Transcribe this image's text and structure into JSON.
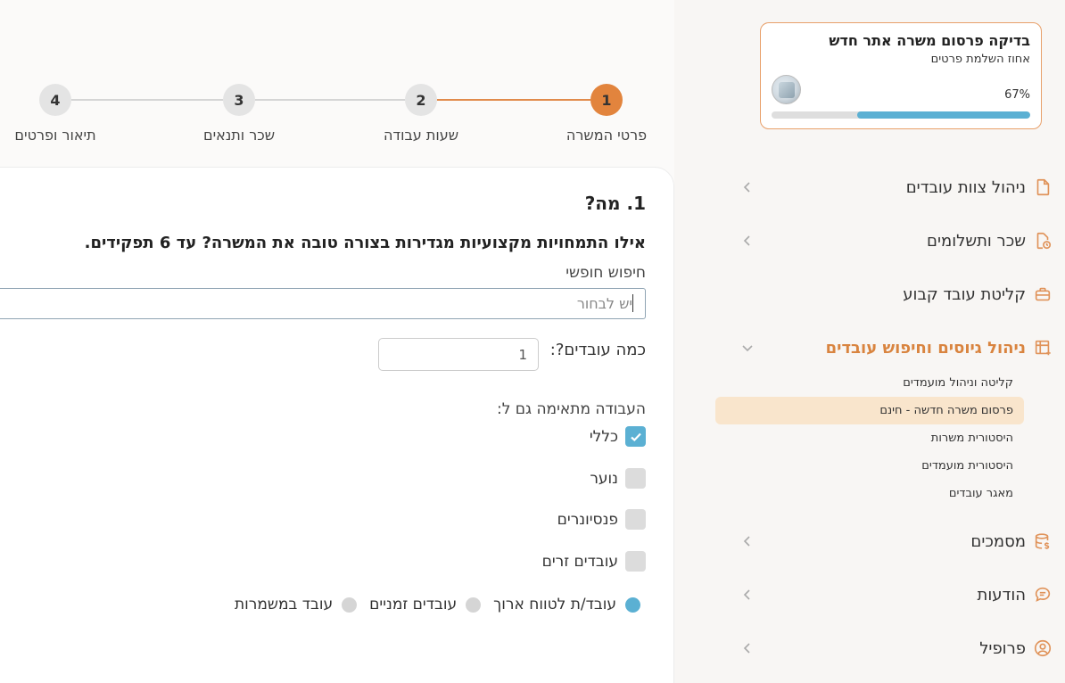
{
  "progress_card": {
    "title": "בדיקה פרסום משרה אתר חדש",
    "subtitle": "אחוז השלמת פרטים",
    "percent_text": "67%",
    "percent": 67
  },
  "nav": {
    "items": [
      {
        "label": "ניהול צוות עובדים",
        "icon": "document-icon"
      },
      {
        "label": "שכר ותשלומים",
        "icon": "file-clock-icon"
      },
      {
        "label": "קליטת עובד קבוע",
        "icon": "briefcase-icon"
      },
      {
        "label": "ניהול גיוסים וחיפוש עובדים",
        "icon": "table-plus-icon"
      },
      {
        "label": "מסמכים",
        "icon": "coins-icon"
      },
      {
        "label": "הודעות",
        "icon": "chat-icon"
      },
      {
        "label": "פרופיל",
        "icon": "user-circle-icon"
      }
    ],
    "sub_items": [
      "קליטה וניהול מועמדים",
      "פרסום משרה חדשה - חינם",
      "היסטורית משרות",
      "היסטורית מועמדים",
      "מאגר עובדים"
    ]
  },
  "stepper": {
    "steps": [
      {
        "number": "1",
        "label": "פרטי המשרה"
      },
      {
        "number": "2",
        "label": "שעות עבודה"
      },
      {
        "number": "3",
        "label": "שכר ותנאים"
      },
      {
        "number": "4",
        "label": "תיאור ופרטים"
      }
    ],
    "active_step": 1
  },
  "form": {
    "title": "1. מה?",
    "question": "אילו התמחויות מקצועיות מגדירות בצורה טובה את המשרה? עד 6 תפקידים.",
    "search_label": "חיפוש חופשי",
    "search_placeholder": "יש לבחור",
    "count_label": "כמה עובדים?:",
    "count_value": "1",
    "fit_label": "העבודה מתאימה גם ל:",
    "checkboxes": [
      {
        "label": "כללי",
        "checked": true
      },
      {
        "label": "נוער",
        "checked": false
      },
      {
        "label": "פנסיונרים",
        "checked": false
      },
      {
        "label": "עובדים זרים",
        "checked": false
      }
    ],
    "radios": [
      {
        "label": "עובד/ת לטווח ארוך",
        "selected": true
      },
      {
        "label": "עובדים זמניים",
        "selected": false
      },
      {
        "label": "עובד במשמרות",
        "selected": false
      }
    ]
  },
  "colors": {
    "accent": "#e2843d",
    "blue": "#5bb0d3",
    "highlight": "#f9e5cc"
  }
}
